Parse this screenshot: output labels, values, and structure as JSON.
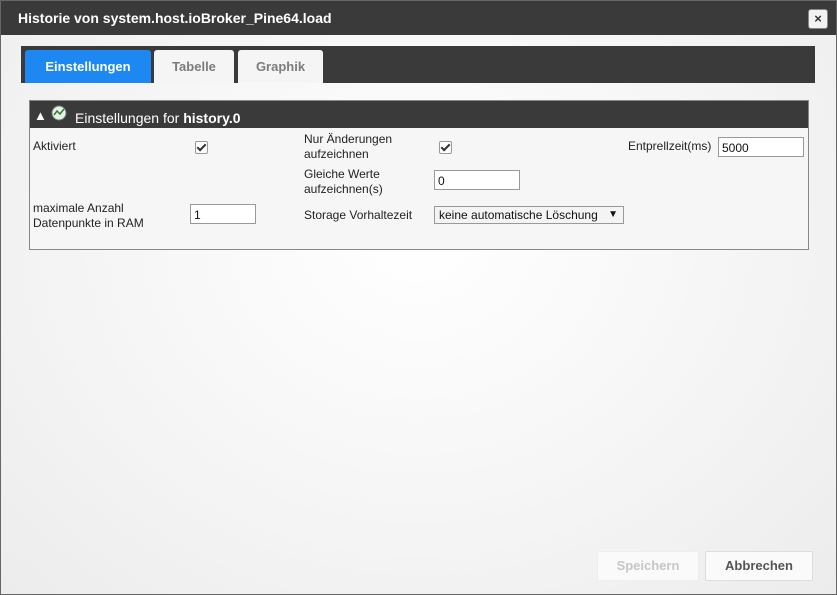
{
  "window": {
    "title": "Historie von system.host.ioBroker_Pine64.load",
    "close_label": "×"
  },
  "tabs": [
    {
      "label": "Einstellungen",
      "active": true
    },
    {
      "label": "Tabelle",
      "active": false
    },
    {
      "label": "Graphik",
      "active": false
    }
  ],
  "panel": {
    "collapse_icon": "▲",
    "title_prefix": "Einstellungen for",
    "title_instance": "history.0"
  },
  "settings": {
    "aktiviert_label": "Aktiviert",
    "aktiviert_checked": true,
    "nur_aenderungen_label_1": "Nur Änderungen",
    "nur_aenderungen_label_2": "aufzeichnen",
    "nur_aenderungen_checked": true,
    "entprellzeit_label": "Entprellzeit(ms)",
    "entprellzeit_value": "5000",
    "gleiche_werte_label_1": "Gleiche Werte",
    "gleiche_werte_label_2": "aufzeichnen(s)",
    "gleiche_werte_value": "0",
    "max_datenpunkte_label_1": "maximale Anzahl",
    "max_datenpunkte_label_2": "Datenpunkte in RAM",
    "max_datenpunkte_value": "1",
    "storage_label": "Storage Vorhaltezeit",
    "storage_value": "keine automatische Löschung",
    "storage_arrow": "▼"
  },
  "buttons": {
    "save_label": "Speichern",
    "save_enabled": false,
    "cancel_label": "Abbrechen"
  },
  "colors": {
    "accent": "#1e88f2",
    "titlebar": "#3a3a3a"
  }
}
